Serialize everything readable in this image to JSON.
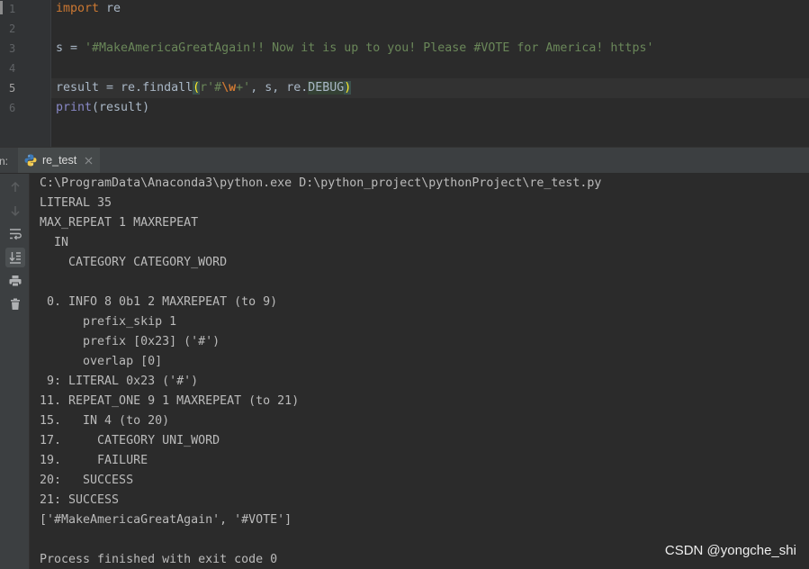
{
  "colors": {
    "editor_bg": "#2b2b2b",
    "panel_bg": "#3c3f41",
    "plain": "#a9b7c6",
    "keyword": "#cc7832",
    "string": "#6a8759",
    "builtin": "#8888c6",
    "brace_match_bg": "#3b514d",
    "brace_match_fg": "#ffef28",
    "current_line_bg": "#323232",
    "console_text": "#bbbbbb"
  },
  "editor": {
    "lines": [
      {
        "number": "1",
        "code": [
          "import",
          " re"
        ]
      },
      {
        "number": "2",
        "code": []
      },
      {
        "number": "3",
        "code": [
          "s = ",
          "'#MakeAmericaGreatAgain!! Now it is up to you! Please #VOTE for America! https'"
        ]
      },
      {
        "number": "4",
        "code": []
      },
      {
        "number": "5",
        "code": [
          "result = re.findall",
          "(",
          "r'#",
          "\\w",
          "+'",
          ", s, re.",
          "DEBUG",
          ")"
        ]
      },
      {
        "number": "6",
        "code": [
          "print",
          "(result)"
        ]
      }
    ]
  },
  "run_panel": {
    "run_label": "n:",
    "tab": {
      "label": "re_test",
      "icon": "python-icon",
      "close_icon": "close-icon"
    },
    "toolbar": [
      {
        "icon": "arrow-up-icon"
      },
      {
        "icon": "arrow-down-icon"
      },
      {
        "icon": "soft-wrap-icon"
      },
      {
        "icon": "scroll-to-end-icon"
      },
      {
        "icon": "print-icon"
      },
      {
        "icon": "trash-icon"
      }
    ]
  },
  "console": {
    "lines": [
      "C:\\ProgramData\\Anaconda3\\python.exe D:\\python_project\\pythonProject\\re_test.py",
      "LITERAL 35",
      "MAX_REPEAT 1 MAXREPEAT",
      "  IN",
      "    CATEGORY CATEGORY_WORD",
      "",
      " 0. INFO 8 0b1 2 MAXREPEAT (to 9)",
      "      prefix_skip 1",
      "      prefix [0x23] ('#')",
      "      overlap [0]",
      " 9: LITERAL 0x23 ('#')",
      "11. REPEAT_ONE 9 1 MAXREPEAT (to 21)",
      "15.   IN 4 (to 20)",
      "17.     CATEGORY UNI_WORD",
      "19.     FAILURE",
      "20:   SUCCESS",
      "21: SUCCESS",
      "['#MakeAmericaGreatAgain', '#VOTE']",
      "",
      "Process finished with exit code 0"
    ]
  },
  "watermark": "CSDN @yongche_shi"
}
